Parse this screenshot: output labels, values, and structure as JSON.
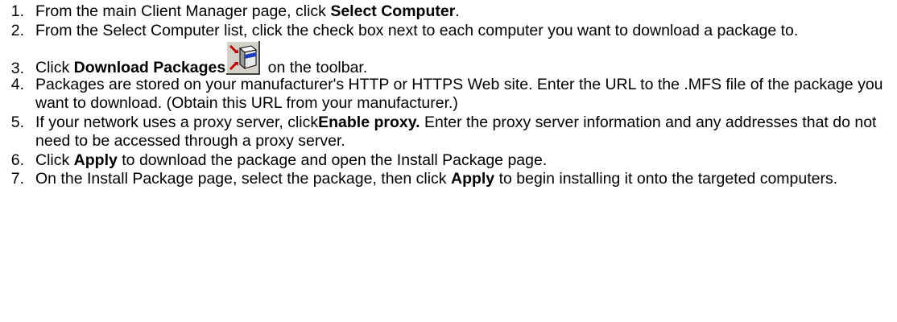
{
  "steps": [
    {
      "number": "1.",
      "pre": "From the main Client Manager page, click ",
      "bold": "Select Computer",
      "post": "."
    },
    {
      "number": "2.",
      "text": "From the Select Computer list, click the check box next to each computer you want to download a package to."
    },
    {
      "number": "3.",
      "pre": "Click ",
      "bold": "Download Packages",
      "icon": "download-packages-icon",
      "post": " on the toolbar."
    },
    {
      "number": "4.",
      "text": "Packages are stored on your manufacturer's HTTP or HTTPS Web site. Enter the URL to the .MFS file of the package you want to download. (Obtain this URL from your manufacturer.)"
    },
    {
      "number": "5.",
      "pre": "If your network uses a proxy server, click",
      "bold": "Enable proxy.",
      "post": " Enter the proxy server information and any addresses that do not need to be accessed through a proxy server."
    },
    {
      "number": "6.",
      "pre": "Click ",
      "bold": "Apply",
      "post": " to download the package and open the Install Package page."
    },
    {
      "number": "7.",
      "pre": "On the Install Package page, select the package, then click ",
      "bold": "Apply",
      "post": " to begin installing it onto the targeted computers."
    }
  ]
}
